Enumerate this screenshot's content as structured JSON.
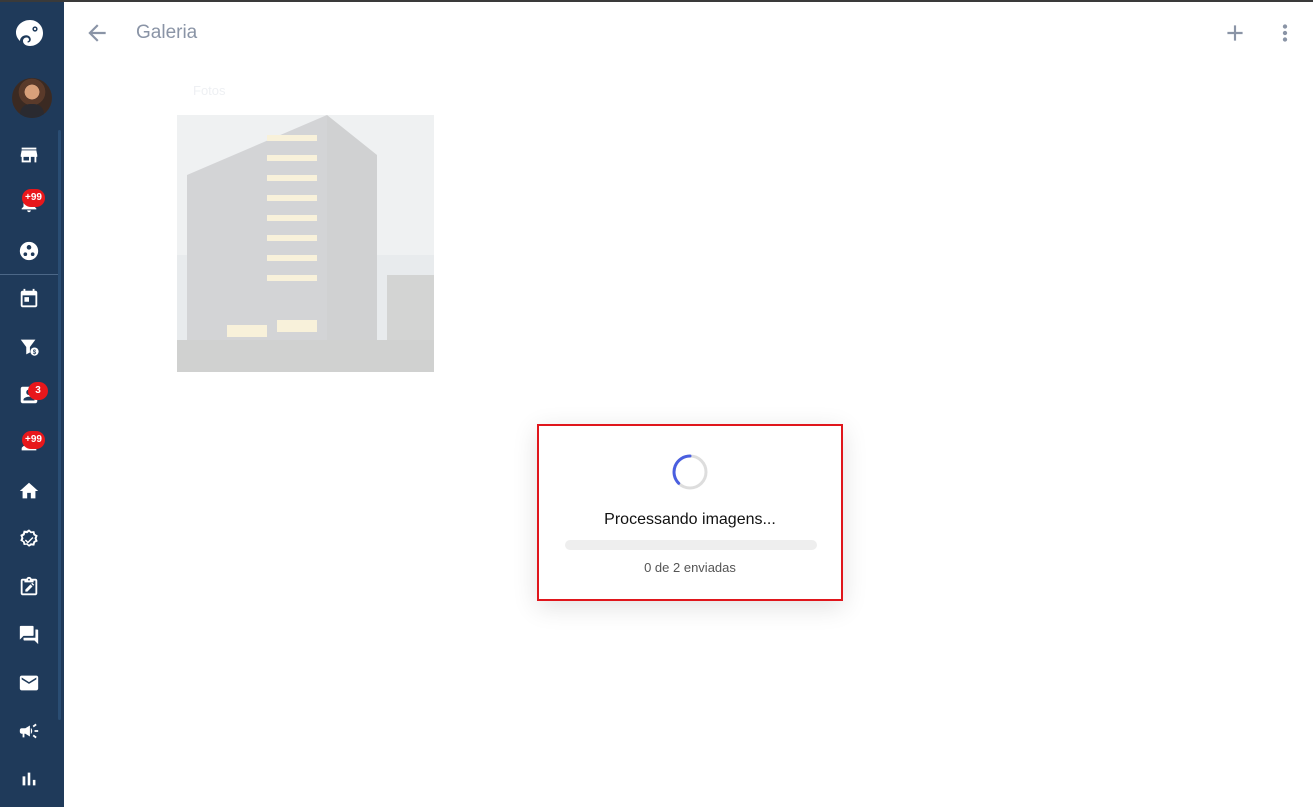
{
  "header": {
    "title": "Galeria"
  },
  "gallery": {
    "section_label": "Fotos"
  },
  "sidebar": {
    "badges": {
      "notifications": "+99",
      "contacts": "3",
      "leads": "+99"
    }
  },
  "upload": {
    "title": "Processando imagens...",
    "status_text": "0 de 2 enviadas",
    "progress": 0
  },
  "colors": {
    "sidebar_bg": "#1f3a5a",
    "badge": "#e8171b",
    "dialog_border": "#e0161c",
    "spinner_accent": "#4a5fe0"
  }
}
